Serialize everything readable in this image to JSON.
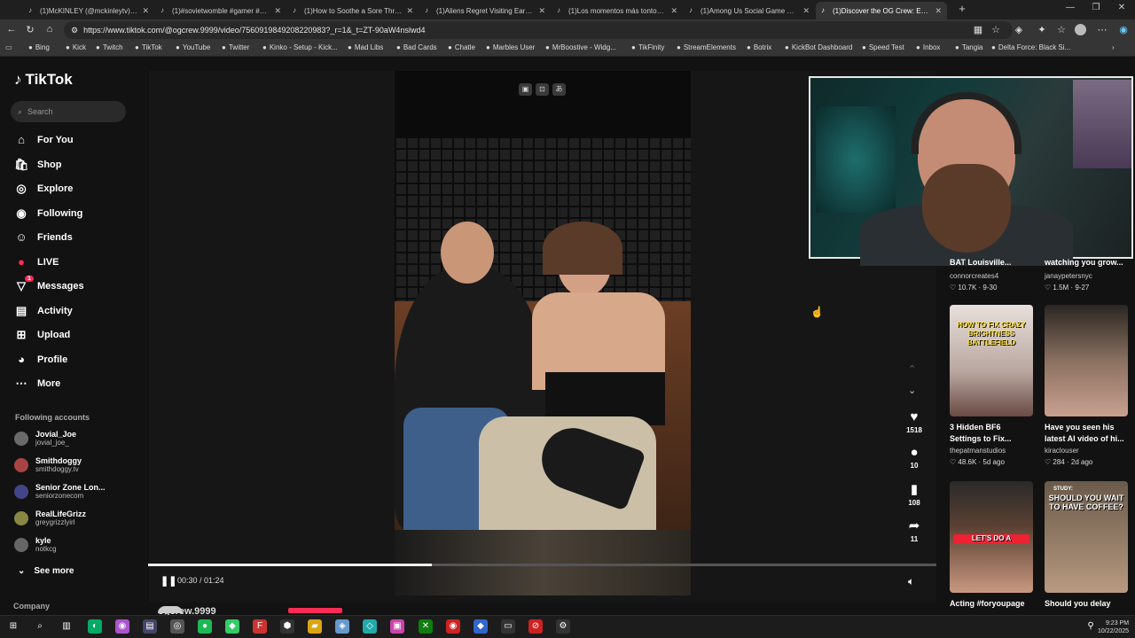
{
  "browser": {
    "tabs": [
      {
        "title": "(1)McKINLEY (@mckinleytv) | TikTok",
        "active": false
      },
      {
        "title": "(1)#sovietwomble #gamer #gami...",
        "active": false
      },
      {
        "title": "(1)How to Soothe a Sore Throat F...",
        "active": false
      },
      {
        "title": "(1)Aliens Regret Visiting Earth Afte...",
        "active": false
      },
      {
        "title": "(1)Los momentos más tontos de...",
        "active": false
      },
      {
        "title": "(1)Among Us Social Game Strate...",
        "active": false
      },
      {
        "title": "(1)Discover the OG Crew: Ep...",
        "active": true
      }
    ],
    "url": "https://www.tiktok.com/@ogcrew.9999/video/7560919849208220983?_r=1&_t=ZT-90aW4nslwd4",
    "bookmarks": [
      "Bing",
      "Kick",
      "Twitch",
      "TikTok",
      "YouTube",
      "Twitter",
      "Kinko - Setup - Kick...",
      "Mad Libs",
      "Bad Cards",
      "Chatle",
      "Marbles User",
      "MrBoostive - Widg...",
      "TikFinity",
      "StreamElements",
      "Botrix",
      "KickBot Dashboard",
      "Speed Test",
      "Inbox",
      "Tangia",
      "Delta Force: Black Si..."
    ]
  },
  "sidebar": {
    "logo": "TikTok",
    "search_placeholder": "Search",
    "nav": [
      {
        "label": "For You",
        "icon": "home-icon"
      },
      {
        "label": "Shop",
        "icon": "shop-icon"
      },
      {
        "label": "Explore",
        "icon": "compass-icon"
      },
      {
        "label": "Following",
        "icon": "following-icon"
      },
      {
        "label": "Friends",
        "icon": "friends-icon"
      },
      {
        "label": "LIVE",
        "icon": "live-icon"
      },
      {
        "label": "Messages",
        "icon": "messages-icon",
        "badge": "1"
      },
      {
        "label": "Activity",
        "icon": "activity-icon"
      },
      {
        "label": "Upload",
        "icon": "upload-icon"
      },
      {
        "label": "Profile",
        "icon": "profile-icon"
      },
      {
        "label": "More",
        "icon": "more-icon"
      }
    ],
    "following_heading": "Following accounts",
    "accounts": [
      {
        "name": "Jovial_Joe",
        "user": "jovial_joe_"
      },
      {
        "name": "Smithdoggy",
        "user": "smithdoggy.tv"
      },
      {
        "name": "Senior Zone Lon...",
        "user": "seniorzonecom"
      },
      {
        "name": "RealLifeGrizz",
        "user": "greygrizzlyirl"
      },
      {
        "name": "kyle",
        "user": "notkcg"
      }
    ],
    "see_more": "See more",
    "company": "Company"
  },
  "player": {
    "time": "00:30 / 01:24",
    "progress": 0.36,
    "author": "ogcrew.9999",
    "actions": {
      "likes": "1518",
      "comments": "10",
      "saves": "108",
      "shares": "11"
    }
  },
  "recommended": [
    {
      "title": "BAT Louisville...",
      "user": "connorcreates4",
      "views": "10.7K",
      "date": "9-30"
    },
    {
      "title": "watching you grow...",
      "user": "janaypetersnyc",
      "views": "1.5M",
      "date": "9-27"
    },
    {
      "title": "3 Hidden BF6 Settings to Fix...",
      "user": "thepatmanstudios",
      "views": "48.6K",
      "date": "5d ago",
      "thumb_text": "HOW TO FIX CRAZY BRIGHTNESS BATTLEFIELD"
    },
    {
      "title": "Have you seen his latest AI video of hi...",
      "user": "kiraclouser",
      "views": "284",
      "date": "2d ago"
    },
    {
      "title": "Acting #foryoupage",
      "user": "",
      "views": "",
      "date": "",
      "thumb_text": "LET'S DO A"
    },
    {
      "title": "Should you delay",
      "user": "",
      "views": "",
      "date": "",
      "thumb_text": "SHOULD YOU WAIT TO HAVE COFFEE?",
      "thumb_sub": "STUDY:"
    }
  ],
  "taskbar": {
    "time": "9:23 PM",
    "date": "10/22/2025"
  },
  "colors": {
    "accent": "#fe2c55",
    "bg": "#121212"
  }
}
